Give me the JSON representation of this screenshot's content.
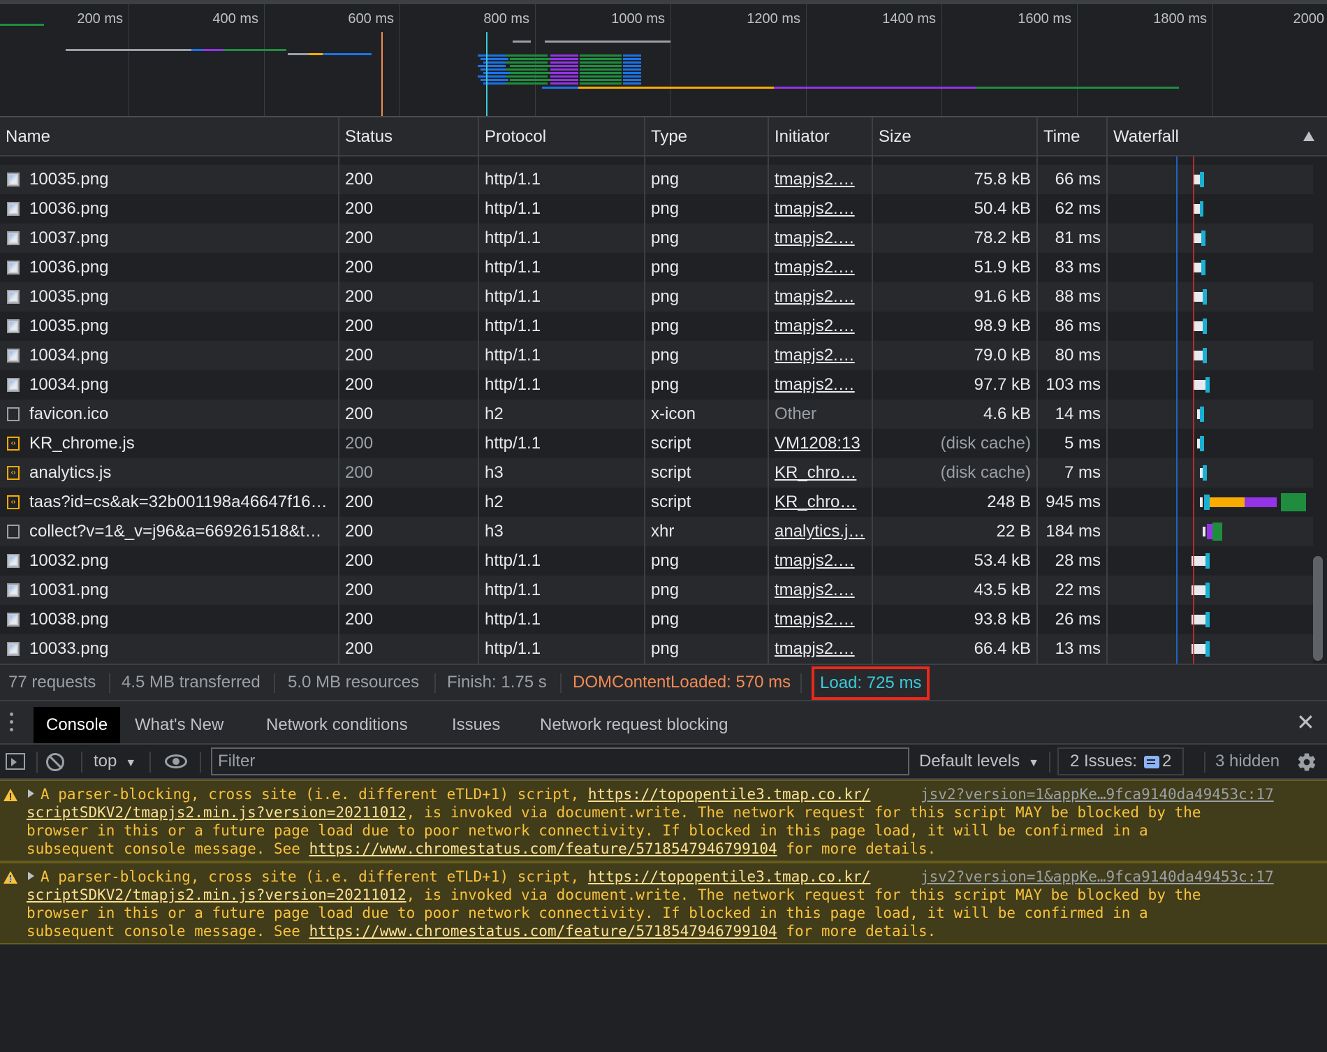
{
  "overview": {
    "ticks": [
      "200 ms",
      "400 ms",
      "600 ms",
      "800 ms",
      "1000 ms",
      "1200 ms",
      "1400 ms",
      "1600 ms",
      "1800 ms",
      "2000"
    ]
  },
  "columns": {
    "name": "Name",
    "status": "Status",
    "protocol": "Protocol",
    "type": "Type",
    "initiator": "Initiator",
    "size": "Size",
    "time": "Time",
    "waterfall": "Waterfall"
  },
  "rows": [
    {
      "name": "10035.png",
      "icon": "png",
      "status": "200",
      "protocol": "http/1.1",
      "type": "png",
      "initiator": "tmapjs2.…",
      "size": "75.8 kB",
      "time": "66 ms"
    },
    {
      "name": "10036.png",
      "icon": "png",
      "status": "200",
      "protocol": "http/1.1",
      "type": "png",
      "initiator": "tmapjs2.…",
      "size": "50.4 kB",
      "time": "62 ms"
    },
    {
      "name": "10037.png",
      "icon": "png",
      "status": "200",
      "protocol": "http/1.1",
      "type": "png",
      "initiator": "tmapjs2.…",
      "size": "78.2 kB",
      "time": "81 ms"
    },
    {
      "name": "10036.png",
      "icon": "png",
      "status": "200",
      "protocol": "http/1.1",
      "type": "png",
      "initiator": "tmapjs2.…",
      "size": "51.9 kB",
      "time": "83 ms"
    },
    {
      "name": "10035.png",
      "icon": "png",
      "status": "200",
      "protocol": "http/1.1",
      "type": "png",
      "initiator": "tmapjs2.…",
      "size": "91.6 kB",
      "time": "88 ms"
    },
    {
      "name": "10035.png",
      "icon": "png",
      "status": "200",
      "protocol": "http/1.1",
      "type": "png",
      "initiator": "tmapjs2.…",
      "size": "98.9 kB",
      "time": "86 ms"
    },
    {
      "name": "10034.png",
      "icon": "png",
      "status": "200",
      "protocol": "http/1.1",
      "type": "png",
      "initiator": "tmapjs2.…",
      "size": "79.0 kB",
      "time": "80 ms"
    },
    {
      "name": "10034.png",
      "icon": "png",
      "status": "200",
      "protocol": "http/1.1",
      "type": "png",
      "initiator": "tmapjs2.…",
      "size": "97.7 kB",
      "time": "103 ms"
    },
    {
      "name": "favicon.ico",
      "icon": "doc",
      "status": "200",
      "protocol": "h2",
      "type": "x-icon",
      "initiator": "Other",
      "size": "4.6 kB",
      "time": "14 ms"
    },
    {
      "name": "KR_chrome.js",
      "icon": "js",
      "status": "200",
      "protocol": "http/1.1",
      "type": "script",
      "initiator": "VM1208:13",
      "size": "(disk cache)",
      "time": "5 ms"
    },
    {
      "name": "analytics.js",
      "icon": "js",
      "status": "200",
      "protocol": "h3",
      "type": "script",
      "initiator": "KR_chro…",
      "size": "(disk cache)",
      "time": "7 ms"
    },
    {
      "name": "taas?id=cs&ak=32b001198a46647f16…",
      "icon": "js",
      "status": "200",
      "protocol": "h2",
      "type": "script",
      "initiator": "KR_chro…",
      "size": "248 B",
      "time": "945 ms"
    },
    {
      "name": "collect?v=1&_v=j96&a=669261518&t=…",
      "icon": "doc",
      "status": "200",
      "protocol": "h3",
      "type": "xhr",
      "initiator": "analytics.j…",
      "size": "22 B",
      "time": "184 ms"
    },
    {
      "name": "10032.png",
      "icon": "png",
      "status": "200",
      "protocol": "http/1.1",
      "type": "png",
      "initiator": "tmapjs2.…",
      "size": "53.4 kB",
      "time": "28 ms"
    },
    {
      "name": "10031.png",
      "icon": "png",
      "status": "200",
      "protocol": "http/1.1",
      "type": "png",
      "initiator": "tmapjs2.…",
      "size": "43.5 kB",
      "time": "22 ms"
    },
    {
      "name": "10038.png",
      "icon": "png",
      "status": "200",
      "protocol": "http/1.1",
      "type": "png",
      "initiator": "tmapjs2.…",
      "size": "93.8 kB",
      "time": "26 ms"
    },
    {
      "name": "10033.png",
      "icon": "png",
      "status": "200",
      "protocol": "http/1.1",
      "type": "png",
      "initiator": "tmapjs2.…",
      "size": "66.4 kB",
      "time": "13 ms"
    }
  ],
  "summary": {
    "requests": "77 requests",
    "transferred": "4.5 MB transferred",
    "resources": "5.0 MB resources",
    "finish": "Finish: 1.75 s",
    "dcl": "DOMContentLoaded: 570 ms",
    "load": "Load: 725 ms"
  },
  "drawer": {
    "tabs": [
      "Console",
      "What's New",
      "Network conditions",
      "Issues",
      "Network request blocking"
    ],
    "active_tab": "Console"
  },
  "console_toolbar": {
    "context": "top",
    "filter_placeholder": "Filter",
    "levels": "Default levels",
    "issues_label": "2 Issues:",
    "issues_count": "2",
    "hidden": "3 hidden"
  },
  "messages": [
    {
      "line1_text": "A parser-blocking, cross site (i.e. different eTLD+1) script, ",
      "line1_link": "https://topopentile3.tmap.co.kr/",
      "source": "jsv2?version=1&appKe…9fca9140da49453c:17",
      "line2_link": "scriptSDKV2/tmapjs2.min.js?version=20211012",
      "line2_text": ", is invoked via document.write. The network request for this script MAY be blocked by the",
      "line3_text": "browser in this or a future page load due to poor network connectivity. If blocked in this page load, it will be confirmed in a",
      "line4_pre": "subsequent console message. See ",
      "line4_link": "https://www.chromestatus.com/feature/5718547946799104",
      "line4_post": " for more details."
    },
    {
      "line1_text": "A parser-blocking, cross site (i.e. different eTLD+1) script, ",
      "line1_link": "https://topopentile3.tmap.co.kr/",
      "source": "jsv2?version=1&appKe…9fca9140da49453c:17",
      "line2_link": "scriptSDKV2/tmapjs2.min.js?version=20211012",
      "line2_text": ", is invoked via document.write. The network request for this script MAY be blocked by the",
      "line3_text": "browser in this or a future page load due to poor network connectivity. If blocked in this page load, it will be confirmed in a",
      "line4_pre": "subsequent console message. See ",
      "line4_link": "https://www.chromestatus.com/feature/5718547946799104",
      "line4_post": " for more details."
    }
  ],
  "colors": {
    "dcl": "#f28b54",
    "load": "#3bc9db",
    "highlight_box": "#e8291c",
    "warning_bg": "#413c1a",
    "warning_text": "#f9c23c"
  }
}
